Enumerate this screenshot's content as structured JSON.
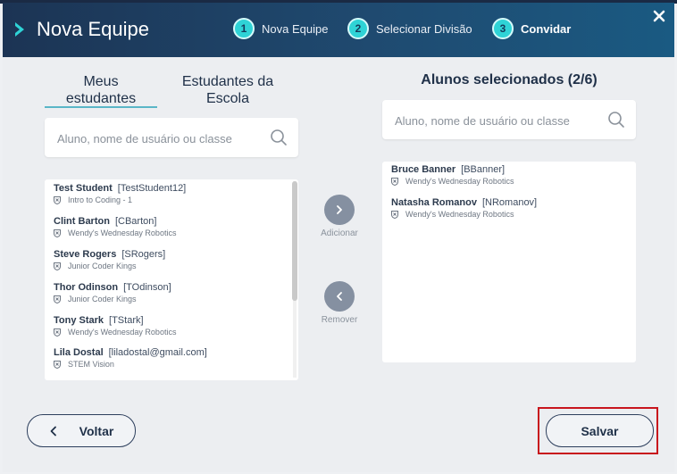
{
  "header": {
    "title": "Nova Equipe",
    "steps": [
      {
        "num": "1",
        "label": "Nova Equipe"
      },
      {
        "num": "2",
        "label": "Selecionar Divisão"
      },
      {
        "num": "3",
        "label": "Convidar"
      }
    ]
  },
  "left": {
    "tabs": {
      "my_students_line1": "Meus",
      "my_students_line2": "estudantes",
      "school_line1": "Estudantes da",
      "school_line2": "Escola"
    },
    "search_placeholder": "Aluno, nome de usuário ou classe",
    "students": [
      {
        "name": "Test Student",
        "username": "[TestStudent12]",
        "class": "Intro to Coding - 1"
      },
      {
        "name": "Clint Barton",
        "username": "[CBarton]",
        "class": "Wendy's Wednesday Robotics"
      },
      {
        "name": "Steve Rogers",
        "username": "[SRogers]",
        "class": "Junior Coder Kings"
      },
      {
        "name": "Thor Odinson",
        "username": "[TOdinson]",
        "class": "Junior Coder Kings"
      },
      {
        "name": "Tony Stark",
        "username": "[TStark]",
        "class": "Wendy's Wednesday Robotics"
      },
      {
        "name": "Lila Dostal",
        "username": "[liladostal@gmail.com]",
        "class": "STEM Vision"
      }
    ]
  },
  "middle": {
    "add_label": "Adicionar",
    "remove_label": "Remover"
  },
  "right": {
    "heading": "Alunos selecionados (2/6)",
    "search_placeholder": "Aluno, nome de usuário ou classe",
    "selected": [
      {
        "name": "Bruce Banner",
        "username": "[BBanner]",
        "class": "Wendy's Wednesday Robotics"
      },
      {
        "name": "Natasha Romanov",
        "username": "[NRomanov]",
        "class": "Wendy's Wednesday Robotics"
      }
    ]
  },
  "footer": {
    "back_label": "Voltar",
    "save_label": "Salvar"
  },
  "colors": {
    "header_bg": "#1f4a70",
    "step_accent": "#2fd3d6",
    "highlight": "#c8151d"
  }
}
